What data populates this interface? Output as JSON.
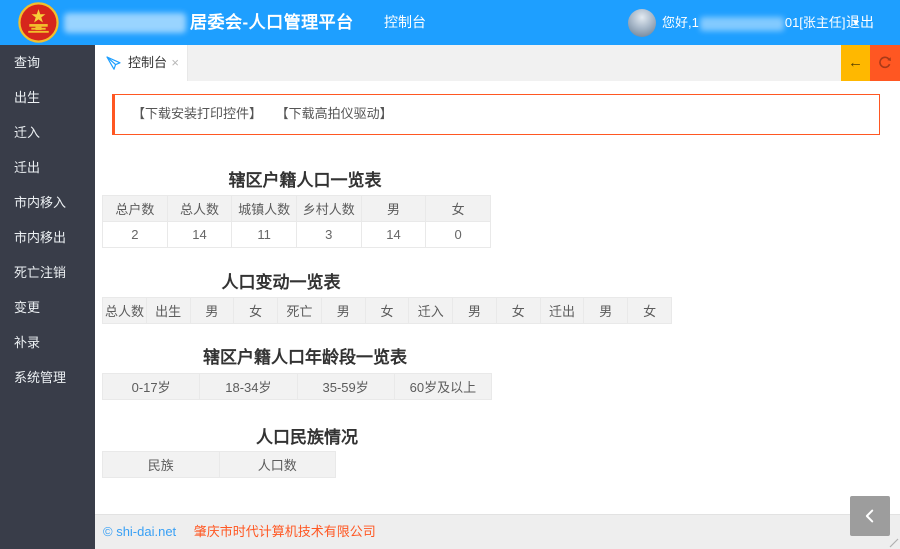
{
  "app": {
    "title_suffix": "居委会-人口管理平台"
  },
  "header": {
    "nav_console": "控制台",
    "greeting_prefix": "您好,1",
    "greeting_suffix": "01[张主任]",
    "logout": "退出"
  },
  "sidebar": {
    "items": [
      "查询",
      "出生",
      "迁入",
      "迁出",
      "市内移入",
      "市内移出",
      "死亡注销",
      "变更",
      "补录",
      "系统管理"
    ]
  },
  "tabbar": {
    "active_tab": "控制台"
  },
  "notice": {
    "link1": "【下载安装打印控件】",
    "link2": "【下载高拍仪驱动】"
  },
  "sections": [
    {
      "title": "辖区户籍人口一览表",
      "headers": [
        "总户数",
        "总人数",
        "城镇人数",
        "乡村人数",
        "男",
        "女"
      ],
      "rows": [
        [
          "2",
          "14",
          "11",
          "3",
          "14",
          "0"
        ]
      ]
    },
    {
      "title": "人口变动一览表",
      "headers": [
        "总人数",
        "出生",
        "男",
        "女",
        "死亡",
        "男",
        "女",
        "迁入",
        "男",
        "女",
        "迁出",
        "男",
        "女"
      ],
      "rows": []
    },
    {
      "title": "辖区户籍人口年龄段一览表",
      "headers": [
        "0-17岁",
        "18-34岁",
        "35-59岁",
        "60岁及以上"
      ],
      "rows": []
    },
    {
      "title": "人口民族情况",
      "headers": [
        "民族",
        "人口数"
      ],
      "rows": []
    }
  ],
  "footer": {
    "copyright": "© shi-dai.net",
    "company": "肇庆市时代计算机技术有限公司"
  },
  "icons": {
    "close": "×",
    "caret_down": "▼",
    "back_arrow": "←",
    "paper_plane": "paper-plane-svg",
    "refresh": "circular-arrow-svg",
    "chevron_left": "chevron-left-svg",
    "national_emblem": "china-emblem-svg"
  },
  "colors": {
    "header_blue": "#1E9FFF",
    "sidebar_dark": "#393D49",
    "accent_orange": "#FF5722",
    "accent_yellow": "#FFB800",
    "footer_link_blue": "#38a0f5"
  }
}
